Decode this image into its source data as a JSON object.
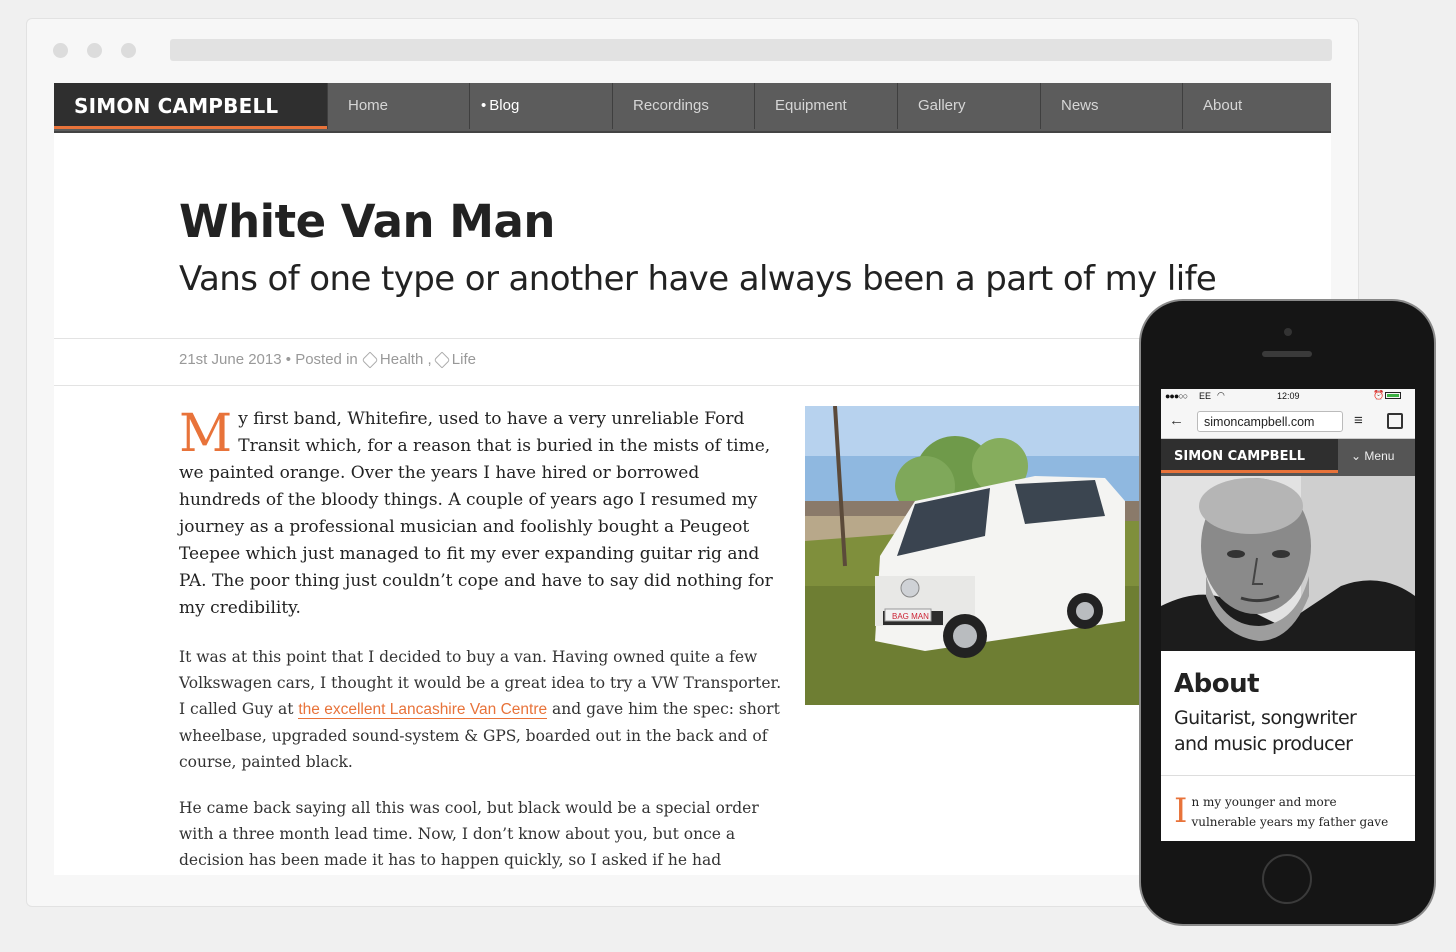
{
  "site": {
    "brand": "SIMON CAMPBELL",
    "nav": [
      {
        "label": "Home",
        "active": false
      },
      {
        "label": "Blog",
        "active": true
      },
      {
        "label": "Recordings",
        "active": false
      },
      {
        "label": "Equipment",
        "active": false
      },
      {
        "label": "Gallery",
        "active": false
      },
      {
        "label": "News",
        "active": false
      },
      {
        "label": "About",
        "active": false
      }
    ],
    "active_bullet": "•"
  },
  "post": {
    "title": "White Van Man",
    "subtitle": "Vans of one type or another have always been a part of my life",
    "date": "21st June 2013",
    "separator": "•",
    "posted_in": "Posted in",
    "tags": [
      "Health",
      "Life"
    ],
    "tag_separator": ",",
    "dropcap": "M",
    "para1_rest": "y first band, Whitefire, used to have a very unreliable Ford Transit which, for a reason that is buried in the mists of time, we painted orange. Over the years I have hired or borrowed hundreds of the bloody things. A couple of years ago I resumed my journey as a professional musician and foolishly bought a Peugeot Teepee which just managed to fit my ever expanding guitar rig and PA. The poor thing just couldn’t cope and have to say did nothing for my credibility.",
    "para2_before": "It was at this point that I decided to buy a van. Having owned quite a few Volkswagen cars, I thought it would be a great idea to try a VW Transporter. I called Guy at",
    "para2_link": "the excellent Lancashire Van Centre",
    "para2_after": "and gave him the spec: short wheelbase, upgraded sound-system & GPS, boarded out in the back and of course, painted black.",
    "para3": "He came back saying all this was cool, but black would be a special order with a three month lead time. Now, I don’t know about you, but once a decision has been made it has to happen quickly, so I asked if he had",
    "van_plate": "BAG MAN"
  },
  "mobile": {
    "carrier": "EE",
    "time": "12:09",
    "url": "simoncampbell.com",
    "brand": "SIMON CAMPBELL",
    "menu_label": "Menu",
    "heading": "About",
    "subheading": "Guitarist, songwriter and music producer",
    "dropcap": "I",
    "body": "n my younger and more vulnerable years my father gave"
  },
  "colors": {
    "accent": "#e8733a",
    "nav_bg": "#5c5c5c",
    "brand_bg": "#2f2f2f"
  }
}
